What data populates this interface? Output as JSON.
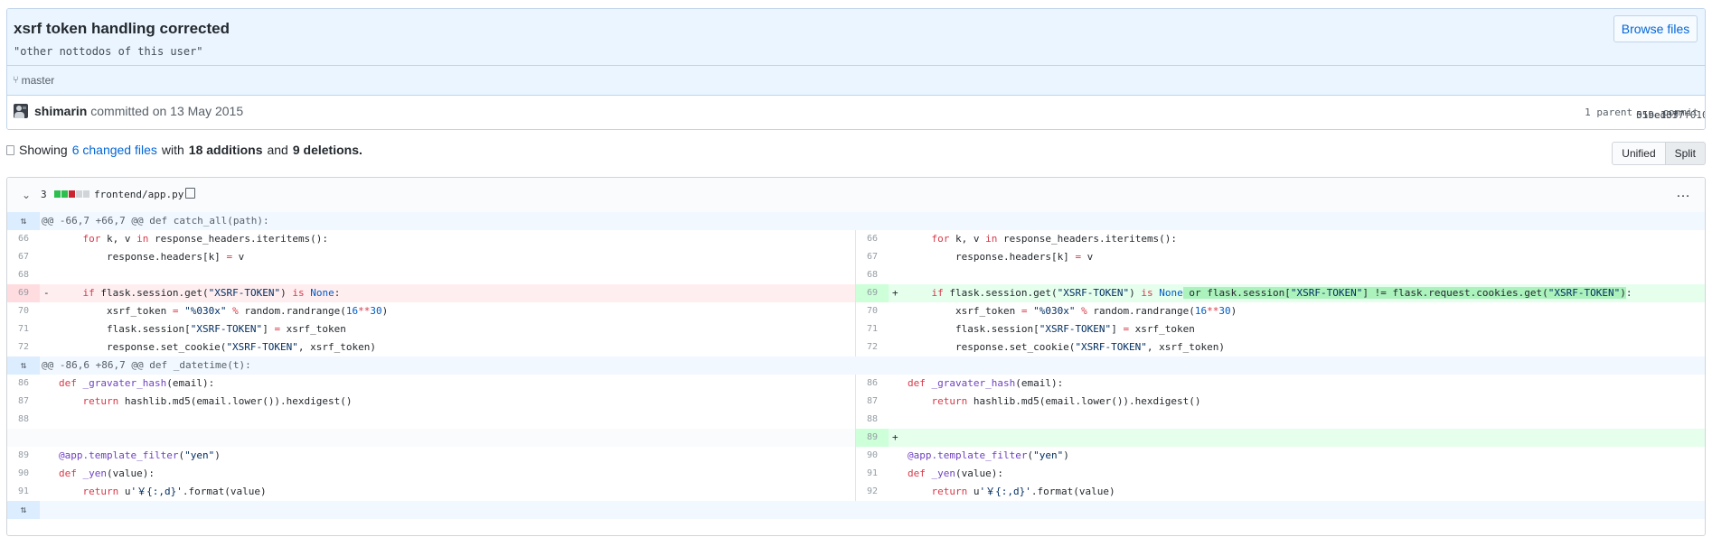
{
  "commit": {
    "title": "xsrf token handling corrected",
    "description": "\"other nottodos of this user\"",
    "browse_files": "Browse files",
    "branch": "master",
    "author": "shimarin",
    "committed_text": "committed on 13 May 2015",
    "parent_label": "1 parent",
    "parent_sha": "059e103",
    "commit_label": "commit",
    "commit_sha": "51bed3f7f01079d91864ddc386a73eb3e1ca634b"
  },
  "toc": {
    "showing": "Showing",
    "changed_files": "6 changed files",
    "with": "with",
    "additions": "18 additions",
    "and": "and",
    "deletions": "9 deletions."
  },
  "view_toggle": {
    "unified": "Unified",
    "split": "Split"
  },
  "file": {
    "changes": "3",
    "name": "frontend/app.py",
    "hunk1": "@@ -66,7 +66,7 @@ def catch_all(path):",
    "hunk2": "@@ -86,6 +86,7 @@ def _datetime(t):",
    "colors": {
      "addition": "#2cbe4e",
      "deletion": "#cb2431",
      "neutral": "#d1d5da"
    }
  },
  "lines": {
    "l66": "66",
    "l67": "67",
    "l68": "68",
    "l69": "69",
    "l70": "70",
    "l71": "71",
    "l72": "72",
    "l86": "86",
    "l87": "87",
    "l88": "88",
    "l89": "89",
    "l90": "90",
    "l91": "91",
    "l92": "92"
  }
}
